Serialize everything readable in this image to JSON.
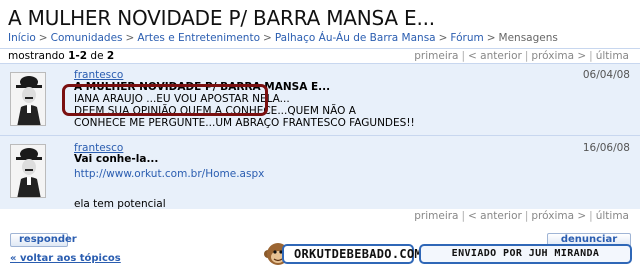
{
  "page": {
    "title": "A MULHER NOVIDADE P/ BARRA MANSA E..."
  },
  "breadcrumb": {
    "items": [
      "Início",
      "Comunidades",
      "Artes e Entretenimento",
      "Palhaço Áu-Áu de Barra Mansa",
      "Fórum"
    ],
    "separator": ">",
    "current": "Mensagens"
  },
  "pager": {
    "showing_prefix": "mostrando",
    "range": "1-2",
    "of_word": "de",
    "total": "2",
    "first": "primeira",
    "prev": "< anterior",
    "next": "próxima >",
    "last": "última"
  },
  "posts": [
    {
      "author": "frantesco",
      "date": "06/04/08",
      "title": "A MULHER NOVIDADE P/ BARRA MANSA E...",
      "lines": [
        "IANA ARAUJO ...EU VOU APOSTAR NELA...",
        "DEEM SUA OPINIÃO QUEM A CONHECE...QUEM NÃO A",
        "CONHECE ME PERGUNTE...UM ABRAÇO FRANTESCO FAGUNDES!!"
      ]
    },
    {
      "author": "frantesco",
      "date": "16/06/08",
      "title": "Vai conhe-la...",
      "link": "http://www.orkut.com.br/Home.aspx",
      "body": "ela tem potencial"
    }
  ],
  "actions": {
    "reply": "responder",
    "report_spam": "denunciar spam",
    "back": "« voltar aos tópicos"
  },
  "watermark": {
    "site": "ORKUTDEBEBADO.COM",
    "credit": "ENVIADO POR JUH MIRANDA"
  },
  "colors": {
    "link": "#2a5db0",
    "post_bg": "#e8f0fa",
    "highlight_border": "#7a1010",
    "badge_border": "#2f67b7"
  }
}
